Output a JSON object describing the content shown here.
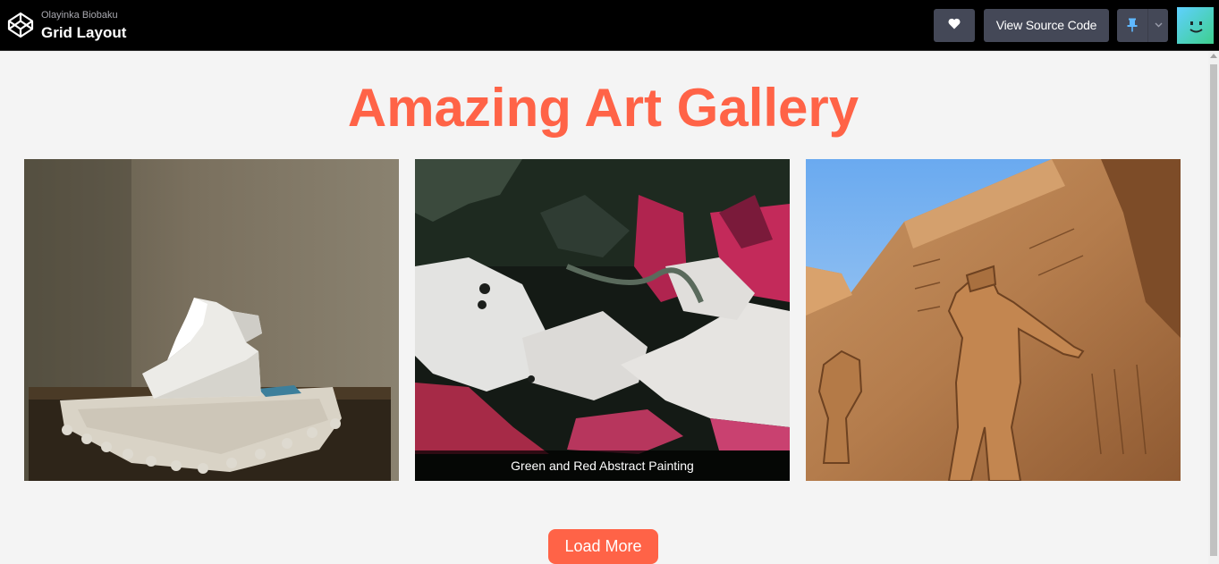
{
  "header": {
    "author": "Olayinka Biobaku",
    "title": "Grid Layout",
    "source_button": "View Source Code",
    "icons": [
      "codepen-logo-icon",
      "heart-icon",
      "pin-icon",
      "chevron-down-icon",
      "avatar-icon"
    ]
  },
  "main": {
    "heading": "Amazing Art Gallery",
    "gallery": [
      {
        "image": "white-bust-sculpture-image",
        "caption": ""
      },
      {
        "image": "abstract-painting-image",
        "caption": "Green and Red Abstract Painting"
      },
      {
        "image": "egyptian-temple-relief-image",
        "caption": ""
      }
    ],
    "load_more_label": "Load More"
  },
  "colors": {
    "accent": "#ff6347",
    "topbar_bg": "#000000",
    "button_bg": "#444857",
    "page_bg": "#f4f4f4"
  }
}
